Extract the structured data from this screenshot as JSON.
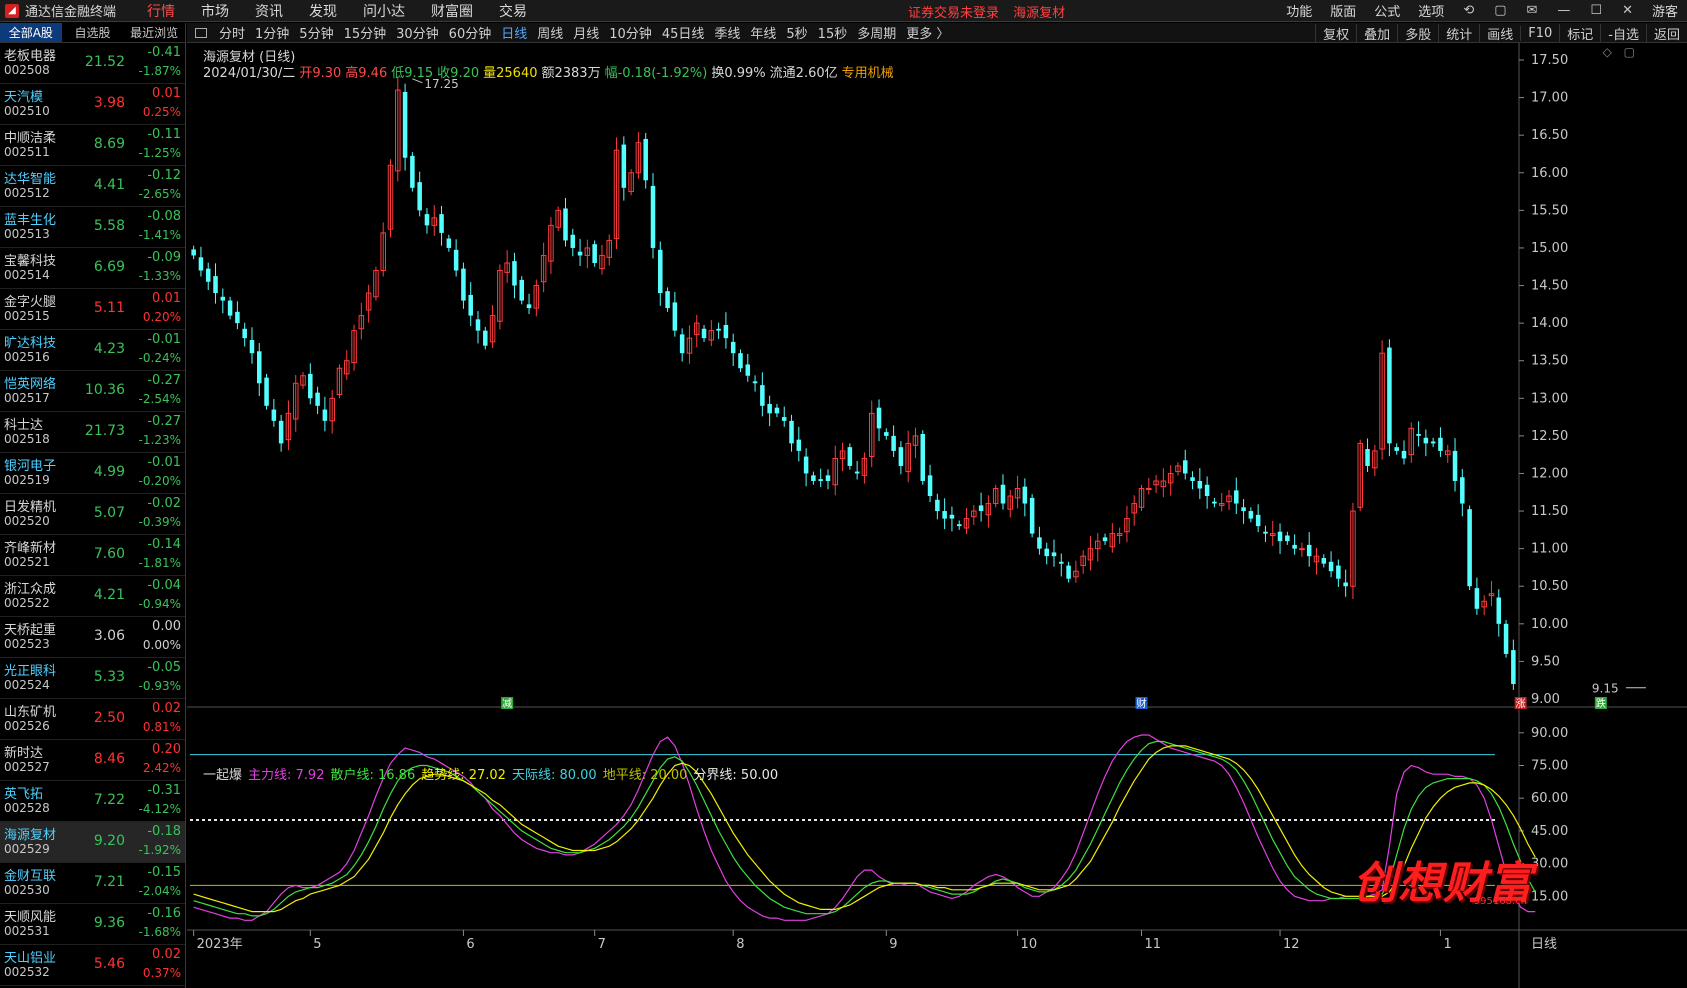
{
  "app": {
    "title": "通达信金融终端",
    "menu": [
      "行情",
      "市场",
      "资讯",
      "发现",
      "问小达",
      "财富圈",
      "交易"
    ],
    "active_menu": 0,
    "notice": [
      "证券交易未登录",
      "海源复材"
    ],
    "right_menu": [
      "功能",
      "版面",
      "公式",
      "选项"
    ],
    "user": "游客"
  },
  "list": {
    "tabs": [
      "全部A股",
      "自选股",
      "最近浏览"
    ],
    "rows": [
      {
        "name": "老板电器",
        "code": "002508",
        "price": "21.52",
        "chg": "-0.41",
        "pct": "-1.87%",
        "dir": "down",
        "nc": "white"
      },
      {
        "name": "天汽模",
        "code": "002510",
        "price": "3.98",
        "chg": "0.01",
        "pct": "0.25%",
        "dir": "up",
        "nc": "blue"
      },
      {
        "name": "中顺洁柔",
        "code": "002511",
        "price": "8.69",
        "chg": "-0.11",
        "pct": "-1.25%",
        "dir": "down",
        "nc": "white"
      },
      {
        "name": "达华智能",
        "code": "002512",
        "price": "4.41",
        "chg": "-0.12",
        "pct": "-2.65%",
        "dir": "down",
        "nc": "blue"
      },
      {
        "name": "蓝丰生化",
        "code": "002513",
        "price": "5.58",
        "chg": "-0.08",
        "pct": "-1.41%",
        "dir": "down",
        "nc": "blue"
      },
      {
        "name": "宝馨科技",
        "code": "002514",
        "price": "6.69",
        "chg": "-0.09",
        "pct": "-1.33%",
        "dir": "down",
        "nc": "white"
      },
      {
        "name": "金字火腿",
        "code": "002515",
        "price": "5.11",
        "chg": "0.01",
        "pct": "0.20%",
        "dir": "up",
        "nc": "white"
      },
      {
        "name": "旷达科技",
        "code": "002516",
        "price": "4.23",
        "chg": "-0.01",
        "pct": "-0.24%",
        "dir": "down",
        "nc": "blue"
      },
      {
        "name": "恺英网络",
        "code": "002517",
        "price": "10.36",
        "chg": "-0.27",
        "pct": "-2.54%",
        "dir": "down",
        "nc": "blue"
      },
      {
        "name": "科士达",
        "code": "002518",
        "price": "21.73",
        "chg": "-0.27",
        "pct": "-1.23%",
        "dir": "down",
        "nc": "white"
      },
      {
        "name": "银河电子",
        "code": "002519",
        "price": "4.99",
        "chg": "-0.01",
        "pct": "-0.20%",
        "dir": "down",
        "nc": "blue"
      },
      {
        "name": "日发精机",
        "code": "002520",
        "price": "5.07",
        "chg": "-0.02",
        "pct": "-0.39%",
        "dir": "down",
        "nc": "white"
      },
      {
        "name": "齐峰新材",
        "code": "002521",
        "price": "7.60",
        "chg": "-0.14",
        "pct": "-1.81%",
        "dir": "down",
        "nc": "white"
      },
      {
        "name": "浙江众成",
        "code": "002522",
        "price": "4.21",
        "chg": "-0.04",
        "pct": "-0.94%",
        "dir": "down",
        "nc": "white"
      },
      {
        "name": "天桥起重",
        "code": "002523",
        "price": "3.06",
        "chg": "0.00",
        "pct": "0.00%",
        "dir": "flat",
        "nc": "white"
      },
      {
        "name": "光正眼科",
        "code": "002524",
        "price": "5.33",
        "chg": "-0.05",
        "pct": "-0.93%",
        "dir": "down",
        "nc": "blue"
      },
      {
        "name": "山东矿机",
        "code": "002526",
        "price": "2.50",
        "chg": "0.02",
        "pct": "0.81%",
        "dir": "up",
        "nc": "white"
      },
      {
        "name": "新时达",
        "code": "002527",
        "price": "8.46",
        "chg": "0.20",
        "pct": "2.42%",
        "dir": "up",
        "nc": "white"
      },
      {
        "name": "英飞拓",
        "code": "002528",
        "price": "7.22",
        "chg": "-0.31",
        "pct": "-4.12%",
        "dir": "down",
        "nc": "blue"
      },
      {
        "name": "海源复材",
        "code": "002529",
        "price": "9.20",
        "chg": "-0.18",
        "pct": "-1.92%",
        "dir": "down",
        "nc": "blue",
        "selected": true
      },
      {
        "name": "金财互联",
        "code": "002530",
        "price": "7.21",
        "chg": "-0.15",
        "pct": "-2.04%",
        "dir": "down",
        "nc": "blue"
      },
      {
        "name": "天顺风能",
        "code": "002531",
        "price": "9.36",
        "chg": "-0.16",
        "pct": "-1.68%",
        "dir": "down",
        "nc": "white"
      },
      {
        "name": "天山铝业",
        "code": "002532",
        "price": "5.46",
        "chg": "0.02",
        "pct": "0.37%",
        "dir": "up",
        "nc": "blue"
      }
    ]
  },
  "periods": [
    "分时",
    "1分钟",
    "5分钟",
    "15分钟",
    "30分钟",
    "60分钟",
    "日线",
    "周线",
    "月线",
    "10分钟",
    "45日线",
    "季线",
    "年线",
    "5秒",
    "15秒",
    "多周期",
    "更多 〉"
  ],
  "active_period": 6,
  "tools": [
    "复权",
    "叠加",
    "多股",
    "统计",
    "画线",
    "F10",
    "标记",
    "-自选",
    "返回"
  ],
  "chart": {
    "title": "海源复材 (日线)",
    "info": [
      {
        "t": "2024/01/30/二",
        "c": "#d8d8d8"
      },
      {
        "t": "开9.30",
        "c": "#ff4a4a"
      },
      {
        "t": "高9.46",
        "c": "#ff4a4a"
      },
      {
        "t": "低9.15",
        "c": "#3ac25a"
      },
      {
        "t": "收9.20",
        "c": "#3ac25a"
      },
      {
        "t": "量25640",
        "c": "#f0e000"
      },
      {
        "t": "额2383万",
        "c": "#d8d8d8"
      },
      {
        "t": "幅-0.18(-1.92%)",
        "c": "#3ac25a"
      },
      {
        "t": "换0.99%",
        "c": "#d8d8d8"
      },
      {
        "t": "流通2.60亿",
        "c": "#d8d8d8"
      },
      {
        "t": "专用机械",
        "c": "#f0a000"
      }
    ],
    "indicator": [
      {
        "t": "一起爆",
        "c": "#d8d8d8"
      },
      {
        "t": "主力线: 7.92",
        "c": "#e040e0"
      },
      {
        "t": "散户线: 16.86",
        "c": "#40e040"
      },
      {
        "t": "趋势线: 27.02",
        "c": "#f0f000"
      },
      {
        "t": "天际线: 80.00",
        "c": "#40d0e0"
      },
      {
        "t": "地平线: 20.00",
        "c": "#c0c000"
      },
      {
        "t": "分界线: 50.00",
        "c": "#e8e8e8"
      }
    ],
    "bottom_right_label": "日线",
    "watermark": "创想财富",
    "watermark_sub": "995168.cn"
  },
  "chart_data": {
    "type": "candlestick",
    "price_axis": {
      "min": 9.0,
      "max": 17.5,
      "ticks": [
        "17.50",
        "17.00",
        "16.50",
        "16.00",
        "15.50",
        "15.00",
        "14.50",
        "14.00",
        "13.50",
        "13.00",
        "12.50",
        "12.00",
        "11.50",
        "11.00",
        "10.50",
        "10.00",
        "9.50",
        "9.00"
      ]
    },
    "x_labels": [
      {
        "label": "2023年",
        "i": 0
      },
      {
        "label": "5",
        "i": 16
      },
      {
        "label": "6",
        "i": 37
      },
      {
        "label": "7",
        "i": 55
      },
      {
        "label": "8",
        "i": 74
      },
      {
        "label": "9",
        "i": 95
      },
      {
        "label": "10",
        "i": 113
      },
      {
        "label": "11",
        "i": 130
      },
      {
        "label": "12",
        "i": 149
      },
      {
        "label": "1",
        "i": 171
      }
    ],
    "annotations": {
      "high_label": "17.25",
      "high_i": 30,
      "low_label": "9.15",
      "low_i": 200
    },
    "event_markers": [
      {
        "label": "减",
        "i": 43,
        "color": "#2fa83a"
      },
      {
        "label": "财",
        "i": 130,
        "color": "#2060d0"
      },
      {
        "label": "涨",
        "i": 182,
        "color": "#c02020"
      },
      {
        "label": "跌",
        "i": 193,
        "color": "#2fa83a"
      }
    ],
    "closes": [
      14.9,
      14.7,
      14.55,
      14.4,
      14.3,
      14.1,
      14.0,
      13.8,
      13.6,
      13.2,
      12.9,
      12.7,
      12.4,
      12.8,
      13.2,
      13.3,
      13.0,
      12.9,
      12.7,
      13.0,
      13.4,
      13.5,
      13.9,
      14.1,
      14.4,
      14.7,
      15.2,
      16.1,
      17.1,
      16.2,
      15.8,
      15.5,
      15.3,
      15.4,
      15.2,
      15.0,
      14.7,
      14.3,
      14.1,
      13.9,
      13.7,
      14.1,
      14.7,
      14.8,
      14.5,
      14.3,
      14.2,
      14.5,
      14.9,
      15.3,
      15.5,
      15.1,
      15.0,
      14.9,
      15.0,
      14.8,
      14.9,
      15.1,
      16.3,
      15.8,
      16.0,
      16.4,
      15.9,
      15.0,
      14.4,
      14.2,
      13.9,
      13.6,
      13.8,
      14.0,
      13.8,
      13.9,
      13.9,
      13.8,
      13.6,
      13.4,
      13.3,
      13.2,
      12.9,
      12.8,
      12.8,
      12.7,
      12.4,
      12.3,
      12.0,
      11.9,
      11.9,
      11.9,
      12.2,
      12.3,
      12.1,
      12.0,
      12.2,
      12.8,
      12.6,
      12.5,
      12.3,
      12.1,
      12.4,
      12.5,
      11.9,
      11.7,
      11.5,
      11.4,
      11.4,
      11.3,
      11.4,
      11.5,
      11.5,
      11.6,
      11.8,
      11.6,
      11.7,
      11.8,
      11.6,
      11.2,
      11.0,
      10.9,
      10.9,
      10.8,
      10.6,
      10.7,
      10.9,
      11.0,
      11.1,
      11.1,
      11.2,
      11.2,
      11.4,
      11.6,
      11.8,
      11.8,
      11.9,
      11.9,
      12.0,
      12.1,
      12.0,
      11.9,
      11.8,
      11.7,
      11.6,
      11.6,
      11.7,
      11.6,
      11.5,
      11.4,
      11.3,
      11.2,
      11.2,
      11.1,
      11.1,
      11.0,
      11.0,
      10.9,
      10.9,
      10.8,
      10.7,
      10.6,
      10.5,
      11.5,
      12.4,
      12.1,
      12.3,
      13.6,
      12.4,
      12.3,
      12.2,
      12.6,
      12.5,
      12.4,
      12.4,
      12.3,
      12.3,
      11.9,
      11.6,
      10.5,
      10.2,
      10.3,
      10.4,
      10.0,
      9.6,
      9.2
    ],
    "indicator_axis": {
      "min": 0,
      "max": 100,
      "ticks": [
        "90.00",
        "75.00",
        "60.00",
        "45.00",
        "30.00",
        "15.00"
      ]
    },
    "reference_lines": [
      {
        "name": "天际线",
        "value": 80,
        "color": "#40d0e0"
      },
      {
        "name": "地平线",
        "value": 20,
        "color": "#c0c000"
      },
      {
        "name": "分界线",
        "value": 50,
        "color": "#e8e8e8"
      }
    ],
    "series": [
      {
        "name": "主力线",
        "color": "#e040e0",
        "values": [
          10,
          9,
          8,
          7,
          6,
          5,
          5,
          4,
          4,
          6,
          8,
          12,
          16,
          19,
          20,
          19,
          19,
          20,
          22,
          24,
          26,
          30,
          36,
          44,
          52,
          61,
          69,
          76,
          80,
          83,
          82,
          81,
          79,
          78,
          76,
          74,
          72,
          70,
          67,
          63,
          60,
          55,
          52,
          48,
          44,
          41,
          39,
          37,
          36,
          35,
          35,
          34,
          34,
          35,
          37,
          39,
          42,
          45,
          48,
          52,
          57,
          64,
          72,
          80,
          86,
          88,
          84,
          76,
          66,
          55,
          45,
          36,
          29,
          22,
          17,
          13,
          10,
          8,
          6,
          5,
          5,
          4,
          4,
          4,
          4,
          5,
          6,
          7,
          10,
          14,
          19,
          24,
          27,
          27,
          24,
          22,
          20,
          20,
          21,
          21,
          19,
          17,
          16,
          15,
          14,
          15,
          17,
          20,
          22,
          24,
          25,
          24,
          22,
          19,
          17,
          15,
          15,
          17,
          19,
          23,
          28,
          35,
          44,
          53,
          62,
          70,
          77,
          82,
          86,
          88,
          89,
          89,
          87,
          85,
          83,
          82,
          81,
          80,
          79,
          78,
          77,
          75,
          71,
          65,
          58,
          50,
          42,
          35,
          28,
          22,
          18,
          15,
          14,
          13,
          13,
          13,
          14,
          14,
          15,
          15,
          15,
          15,
          16,
          18,
          38,
          62,
          72,
          75,
          74,
          72,
          71,
          71,
          71,
          70,
          70,
          69,
          66,
          60,
          50,
          38,
          26,
          16,
          10,
          8,
          8
        ]
      },
      {
        "name": "散户线",
        "color": "#40e040",
        "values": [
          13,
          12,
          11,
          10,
          9,
          8,
          7,
          7,
          6,
          6,
          7,
          9,
          12,
          15,
          17,
          18,
          19,
          19,
          20,
          21,
          23,
          25,
          29,
          34,
          40,
          47,
          55,
          62,
          68,
          72,
          74,
          75,
          75,
          74,
          73,
          72,
          70,
          68,
          66,
          63,
          60,
          57,
          54,
          51,
          48,
          45,
          43,
          41,
          39,
          37,
          36,
          35,
          35,
          35,
          36,
          37,
          39,
          41,
          44,
          47,
          51,
          56,
          62,
          68,
          74,
          78,
          79,
          77,
          72,
          66,
          59,
          52,
          45,
          39,
          33,
          28,
          24,
          20,
          17,
          14,
          12,
          10,
          9,
          8,
          7,
          7,
          7,
          7,
          8,
          10,
          13,
          16,
          19,
          21,
          22,
          22,
          21,
          21,
          21,
          21,
          20,
          19,
          18,
          17,
          16,
          16,
          16,
          17,
          19,
          20,
          22,
          23,
          22,
          21,
          19,
          18,
          17,
          17,
          18,
          20,
          23,
          27,
          33,
          39,
          46,
          53,
          60,
          67,
          73,
          78,
          82,
          85,
          86,
          86,
          85,
          84,
          83,
          82,
          81,
          80,
          79,
          78,
          76,
          73,
          68,
          62,
          55,
          48,
          41,
          35,
          29,
          24,
          21,
          18,
          16,
          15,
          14,
          14,
          14,
          14,
          14,
          15,
          15,
          16,
          22,
          34,
          46,
          55,
          61,
          65,
          67,
          68,
          69,
          69,
          69,
          69,
          68,
          66,
          62,
          56,
          48,
          39,
          31,
          23,
          17
        ]
      },
      {
        "name": "趋势线",
        "color": "#f0f000",
        "values": [
          16,
          15,
          14,
          13,
          12,
          11,
          10,
          9,
          8,
          8,
          8,
          8,
          9,
          11,
          13,
          14,
          16,
          17,
          18,
          19,
          20,
          22,
          24,
          28,
          32,
          38,
          44,
          51,
          57,
          62,
          66,
          69,
          70,
          71,
          71,
          70,
          69,
          68,
          66,
          64,
          62,
          59,
          57,
          54,
          51,
          48,
          46,
          44,
          42,
          40,
          38,
          37,
          36,
          36,
          36,
          36,
          37,
          38,
          40,
          43,
          46,
          50,
          55,
          60,
          66,
          71,
          75,
          76,
          75,
          72,
          67,
          62,
          56,
          50,
          44,
          39,
          34,
          30,
          26,
          22,
          19,
          16,
          14,
          12,
          11,
          10,
          9,
          9,
          9,
          10,
          11,
          13,
          15,
          17,
          19,
          20,
          21,
          21,
          21,
          21,
          20,
          20,
          19,
          19,
          18,
          18,
          18,
          18,
          19,
          20,
          21,
          21,
          21,
          21,
          20,
          19,
          18,
          18,
          18,
          19,
          20,
          23,
          27,
          31,
          37,
          43,
          49,
          56,
          62,
          68,
          73,
          78,
          81,
          83,
          84,
          84,
          84,
          83,
          82,
          81,
          80,
          79,
          78,
          76,
          73,
          69,
          64,
          58,
          52,
          46,
          40,
          34,
          29,
          25,
          22,
          19,
          17,
          16,
          15,
          15,
          15,
          15,
          15,
          15,
          17,
          22,
          29,
          37,
          44,
          51,
          56,
          60,
          63,
          65,
          66,
          67,
          67,
          66,
          64,
          61,
          57,
          52,
          46,
          39,
          33
        ]
      }
    ]
  }
}
